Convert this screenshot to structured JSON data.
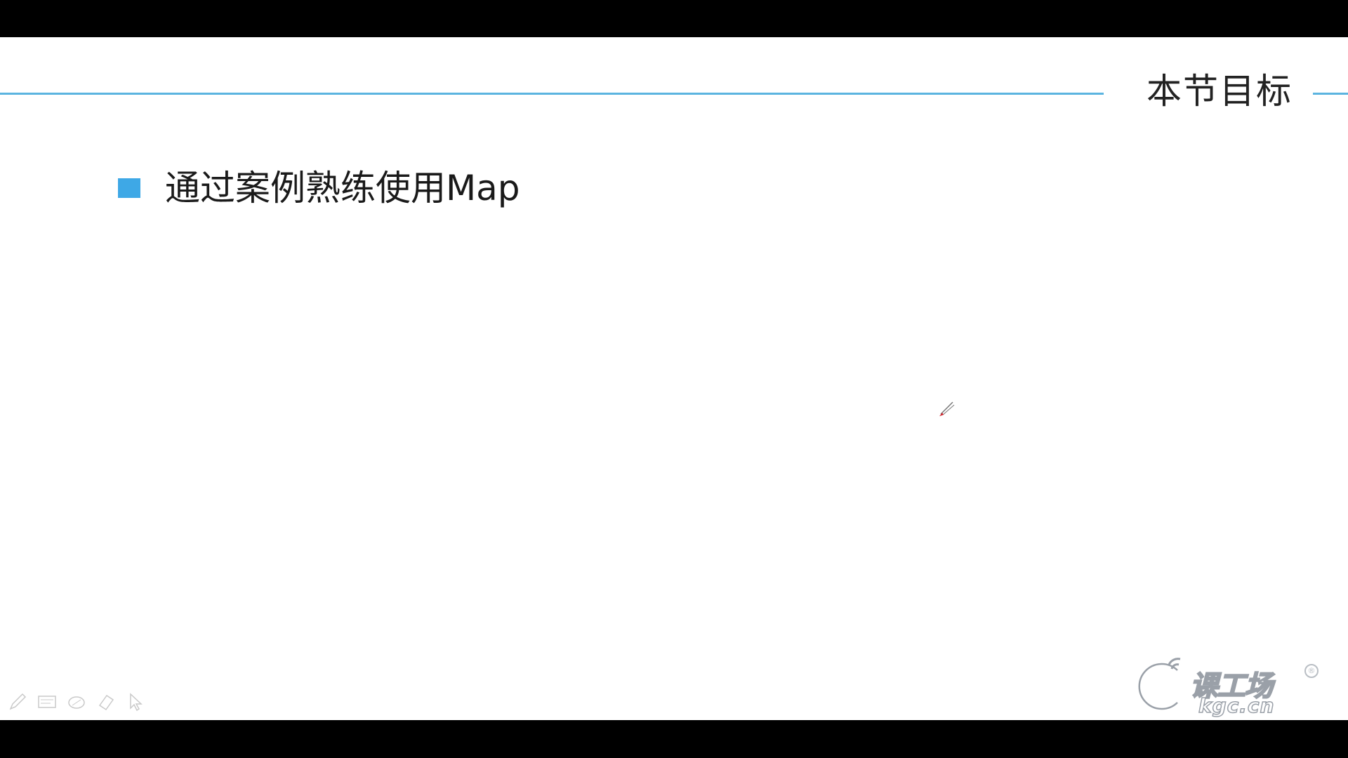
{
  "slide": {
    "title": "本节目标",
    "bullets": [
      {
        "text": "通过案例熟练使用Map"
      }
    ]
  },
  "toolbar": {
    "tools": [
      "pen-icon",
      "whiteboard-icon",
      "highlighter-icon",
      "eraser-icon",
      "pointer-icon"
    ]
  },
  "logo": {
    "name": "课工场",
    "domain": "kgc.cn",
    "registered": "®"
  },
  "colors": {
    "accent": "#3ea8e6",
    "rule": "#5bb4e0",
    "text": "#1a1a1a"
  }
}
